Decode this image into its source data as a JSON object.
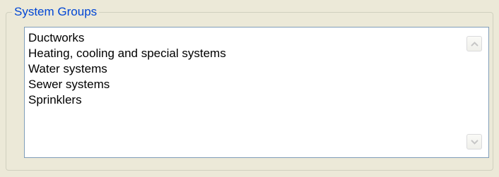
{
  "group": {
    "title": "System Groups"
  },
  "list": {
    "items": [
      {
        "label": "Ductworks"
      },
      {
        "label": "Heating, cooling and special systems"
      },
      {
        "label": "Water systems"
      },
      {
        "label": "Sewer systems"
      },
      {
        "label": "Sprinklers"
      }
    ]
  },
  "scrollbar": {
    "up_icon": "chevron-up-icon",
    "down_icon": "chevron-down-icon",
    "arrow_color": "#c6c6c6"
  },
  "colors": {
    "title": "#0046d5",
    "list_border": "#7f9db9",
    "background": "#ece9d8"
  }
}
